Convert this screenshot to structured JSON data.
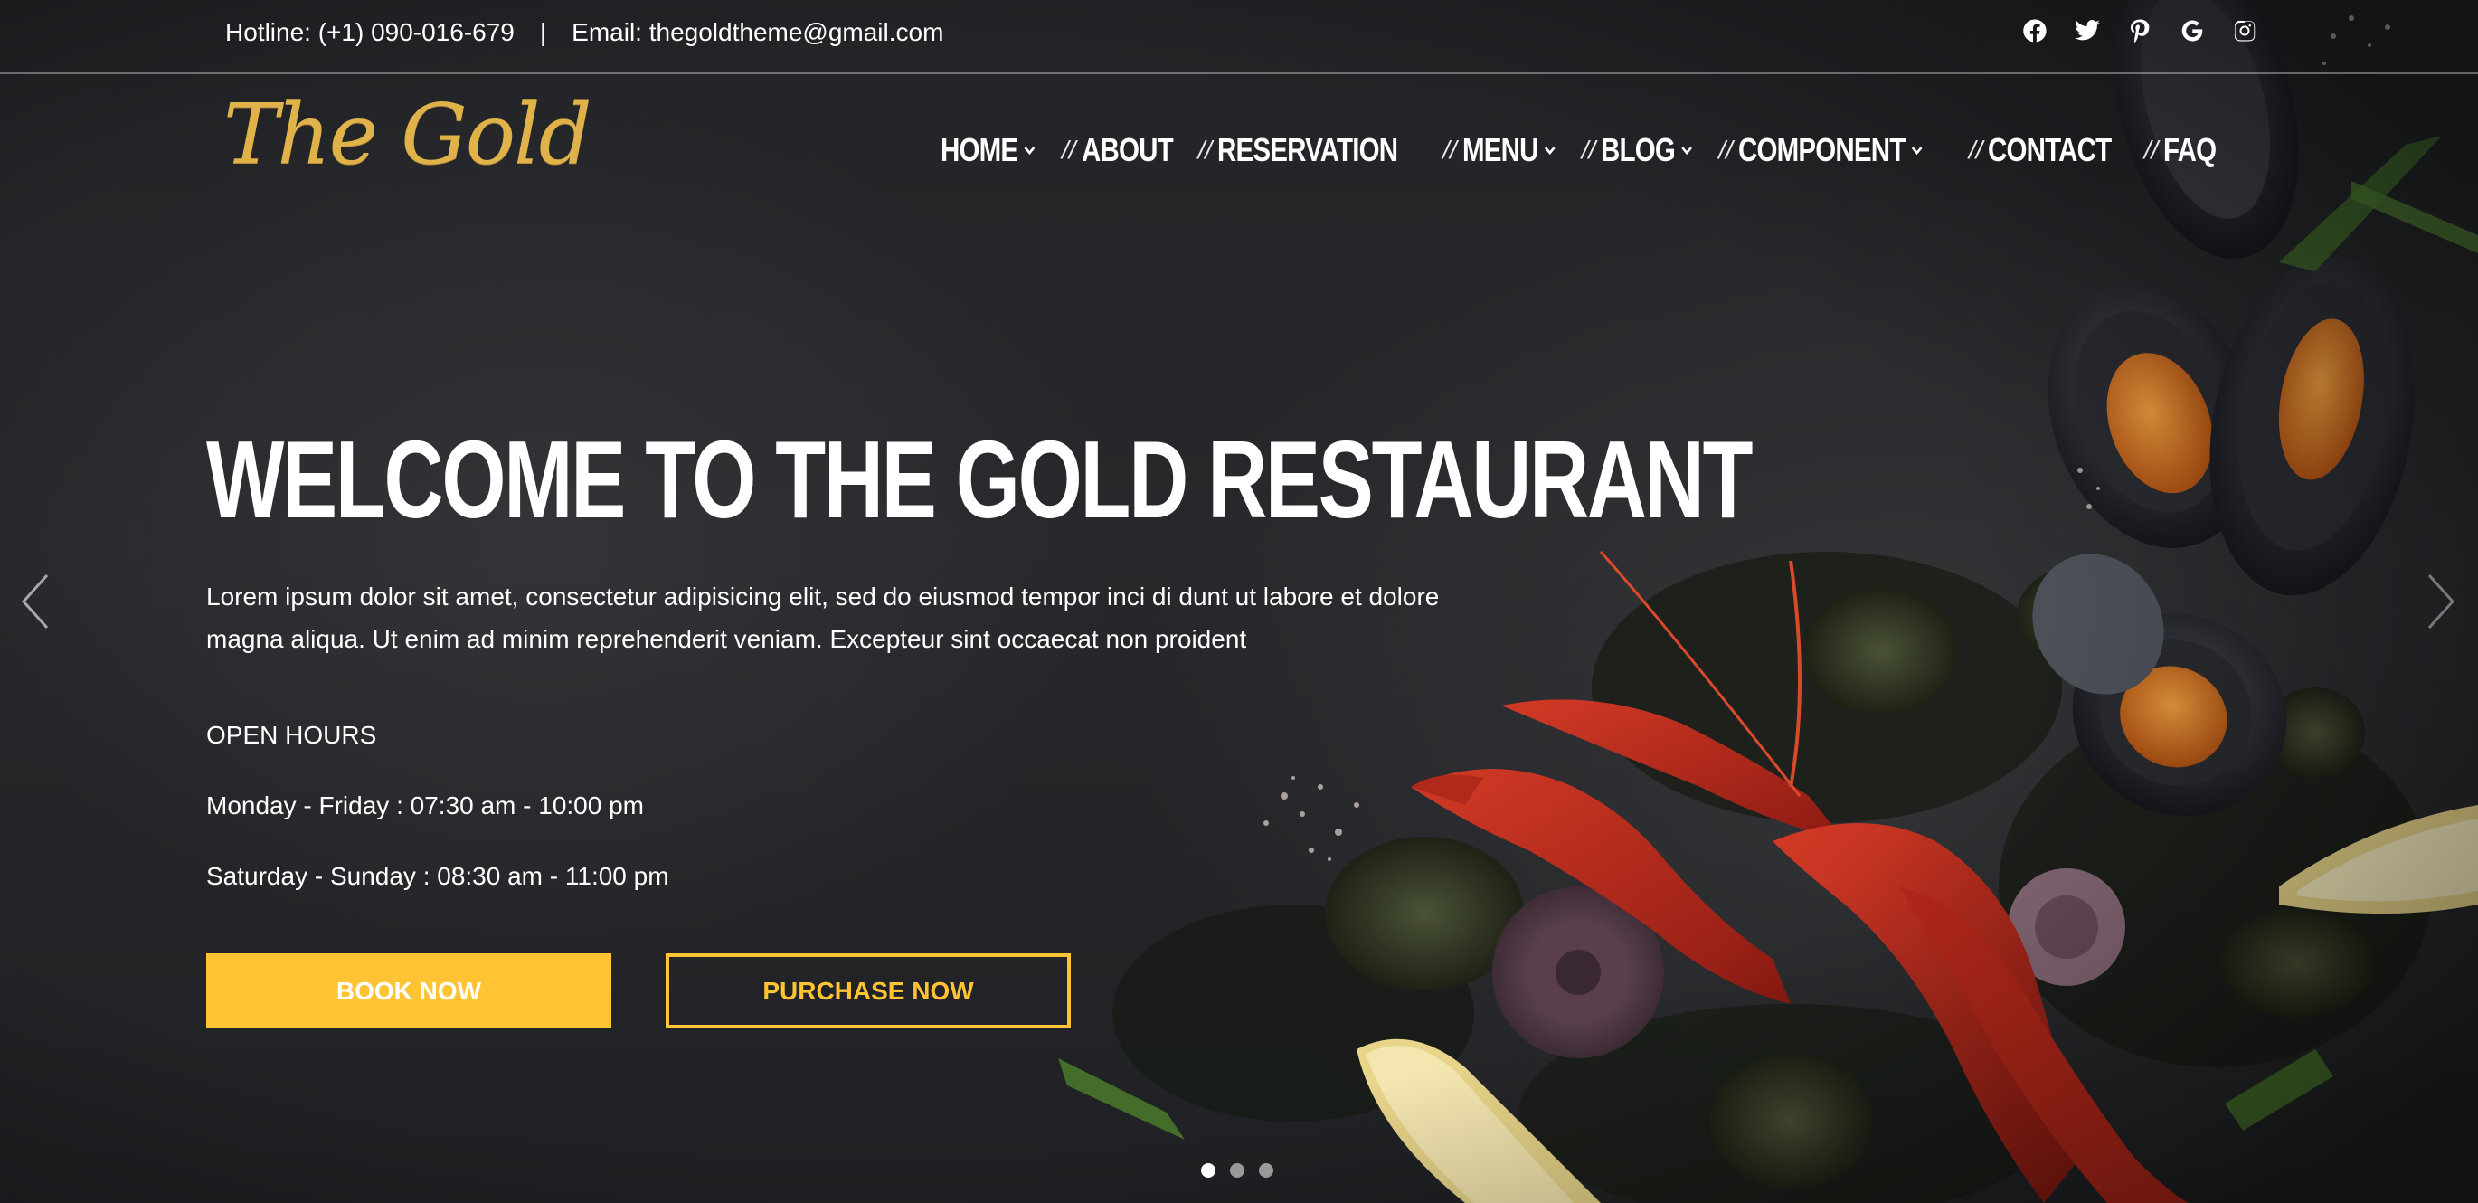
{
  "topbar": {
    "hotline": "Hotline: (+1) 090-016-679",
    "separator": "|",
    "email": "Email: thegoldtheme@gmail.com",
    "socials": [
      "facebook-icon",
      "twitter-icon",
      "pinterest-icon",
      "google-icon",
      "instagram-icon"
    ]
  },
  "header": {
    "logo": "The Gold",
    "nav": [
      {
        "label": "HOME",
        "dropdown": true
      },
      {
        "label": "ABOUT",
        "dropdown": false
      },
      {
        "label": "RESERVATION",
        "dropdown": false
      },
      {
        "label": "MENU",
        "dropdown": true
      },
      {
        "label": "BLOG",
        "dropdown": true
      },
      {
        "label": "COMPONENT",
        "dropdown": true
      },
      {
        "label": "CONTACT",
        "dropdown": false
      },
      {
        "label": "FAQ",
        "dropdown": false
      }
    ],
    "nav_separator": "//"
  },
  "hero": {
    "headline": "WELCOME TO THE GOLD RESTAURANT",
    "lead": "Lorem ipsum dolor sit amet, consectetur adipisicing elit, sed do eiusmod tempor inci di dunt ut labore et dolore magna aliqua. Ut enim ad minim reprehenderit veniam. Excepteur sint occaecat non proident",
    "hours_title": "OPEN HOURS",
    "hours_weekday": "Monday - Friday : 07:30 am - 10:00 pm",
    "hours_weekend": "Saturday - Sunday : 08:30 am - 11:00 pm",
    "book_label": "BOOK NOW",
    "purchase_label": "PURCHASE NOW",
    "slides": 3,
    "active_slide": 1
  },
  "colors": {
    "accent": "#ffc334",
    "logo": "#e0b24a",
    "background": "#222427"
  }
}
